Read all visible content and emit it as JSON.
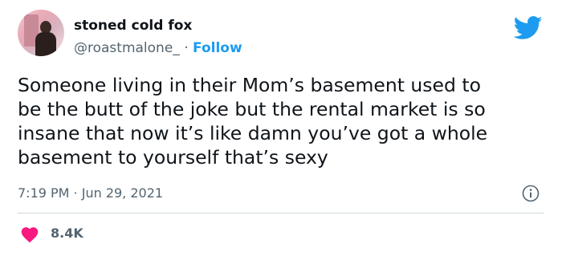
{
  "author": {
    "display_name": "stoned cold fox",
    "handle": "@roastmalone_",
    "separator": " · ",
    "follow_label": "Follow"
  },
  "tweet": {
    "text": "Someone living in their Mom’s basement used to\nbe the butt of the joke but the rental market is so\ninsane that now it’s like damn you’ve got a whole\nbasement to yourself that’s sexy",
    "timestamp": "7:19 PM · Jun 29, 2021"
  },
  "engagement": {
    "likes": "8.4K"
  },
  "icons": {
    "brand": "twitter-bird-icon",
    "info": "info-icon",
    "like": "heart-icon"
  },
  "colors": {
    "accent": "#1d9bf0",
    "heart": "#f91880",
    "text": "#0f1419",
    "muted": "#536471",
    "divider": "#cfd9de"
  }
}
